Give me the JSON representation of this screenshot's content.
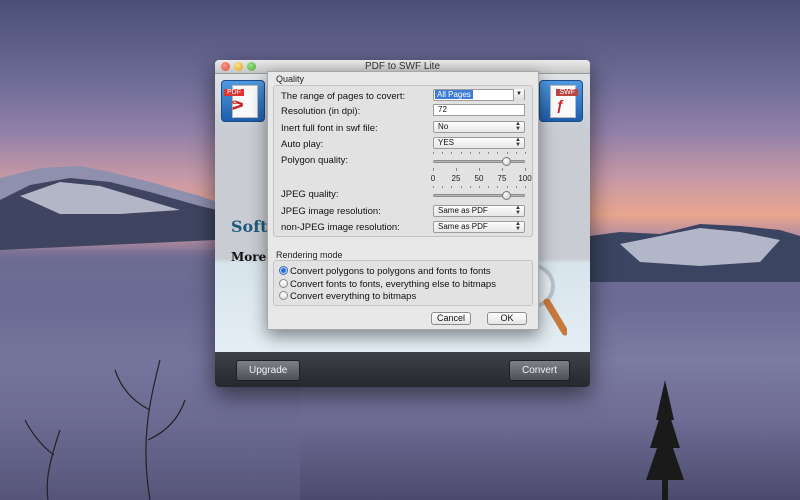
{
  "window": {
    "title": "PDF to SWF Lite",
    "source_icon_tag": "PDF",
    "target_icon_tag": "SWF"
  },
  "promo": {
    "title": "Softt   e            Software",
    "subtitle": "More e    , more power!"
  },
  "bottom_bar": {
    "upgrade_label": "Upgrade",
    "convert_label": "Convert"
  },
  "quality": {
    "group_label": "Quality",
    "page_range": {
      "label": "The range of pages to covert:",
      "value": "All Pages"
    },
    "resolution": {
      "label": "Resolution (in dpi):",
      "value": "72"
    },
    "inert_font": {
      "label": "Inert full font in swf file:",
      "value": "No"
    },
    "auto_play": {
      "label": "Auto play:",
      "value": "YES"
    },
    "polygon_quality": {
      "label": "Polygon quality:",
      "value": 80,
      "ticks": [
        "0",
        "25",
        "50",
        "75",
        "100"
      ]
    },
    "jpeg_quality": {
      "label": "JPEG quality:",
      "value": 80
    },
    "jpeg_resolution": {
      "label": "JPEG image resolution:",
      "value": "Same as PDF"
    },
    "non_jpeg_resolution": {
      "label": "non-JPEG image resolution:",
      "value": "Same as PDF"
    }
  },
  "rendering": {
    "group_label": "Rendering mode",
    "options": [
      {
        "label": "Convert polygons to polygons and fonts to fonts",
        "selected": true
      },
      {
        "label": "Convert fonts to fonts, everything else to bitmaps",
        "selected": false
      },
      {
        "label": "Convert everything to bitmaps",
        "selected": false
      }
    ]
  },
  "dialog_buttons": {
    "cancel_label": "Cancel",
    "ok_label": "OK"
  },
  "colors": {
    "accent": "#3d7bd9",
    "promo_title": "#1e5a7e"
  },
  "icons": {
    "pdf": "pdf-file-icon",
    "swf": "swf-file-icon",
    "magnifier": "magnifying-glass-icon"
  }
}
